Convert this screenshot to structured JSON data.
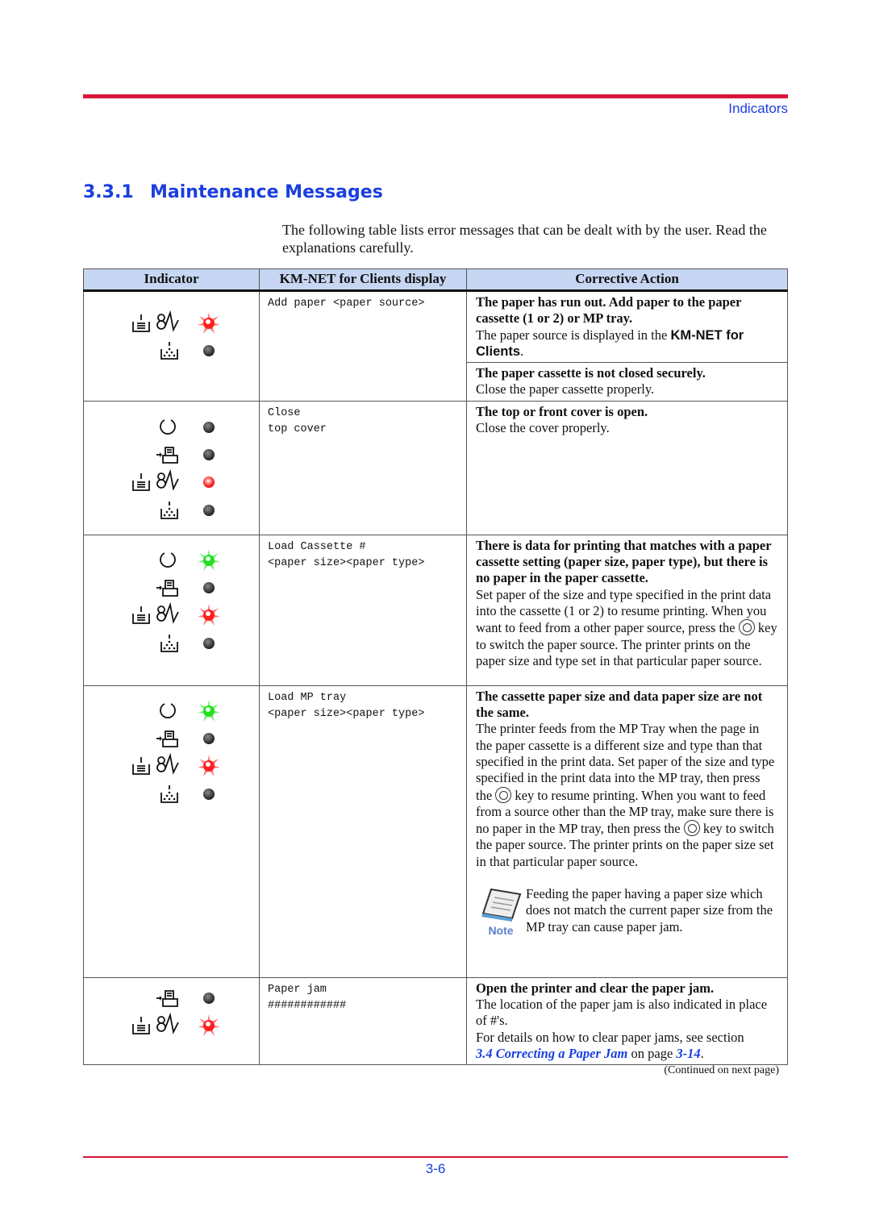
{
  "header": {
    "running_head": "Indicators"
  },
  "section": {
    "number": "3.3.1",
    "title": "Maintenance Messages"
  },
  "intro": "The following table lists error messages that can be dealt with by the user. Read the explanations carefully.",
  "table": {
    "headers": [
      "Indicator",
      "KM-NET for Clients display",
      "Corrective Action"
    ],
    "rows": [
      {
        "indicators": [
          {
            "icon": "paper-jam",
            "led": "red-blink"
          },
          {
            "icon": "toner",
            "led": "off"
          }
        ],
        "display": "Add paper <paper source>",
        "actions": [
          {
            "bold": "The paper has run out. Add paper to the paper cassette (1 or 2) or MP tray.",
            "text": "The paper source is displayed in the ",
            "sans": "KM-NET for Clients",
            "tail": "."
          },
          {
            "bold": "The paper cassette is not closed securely.",
            "text": "Close the paper cassette properly."
          }
        ]
      },
      {
        "indicators": [
          {
            "icon": "ready",
            "led": "off"
          },
          {
            "icon": "data",
            "led": "off"
          },
          {
            "icon": "paper-jam",
            "led": "red-on"
          },
          {
            "icon": "toner",
            "led": "off"
          }
        ],
        "display": "Close\ntop cover",
        "actions": [
          {
            "bold": "The top or front cover is open.",
            "text": "Close the cover properly."
          }
        ]
      },
      {
        "indicators": [
          {
            "icon": "ready",
            "led": "green-blink"
          },
          {
            "icon": "data",
            "led": "off"
          },
          {
            "icon": "paper-jam",
            "led": "red-blink"
          },
          {
            "icon": "toner",
            "led": "off"
          }
        ],
        "display": "Load Cassette #\n<paper size><paper type>",
        "actions": [
          {
            "bold": "There is data for printing that matches with a paper cassette setting (paper size, paper type), but there is no paper in the paper cassette.",
            "text1": "Set paper of the size and type specified in the print data into the cassette (1 or 2) to resume printing. When you want to feed from a other paper source, press the",
            "text2": "key to switch the paper source. The printer prints on the paper size and type set in that particular paper source."
          }
        ]
      },
      {
        "indicators": [
          {
            "icon": "ready",
            "led": "green-blink"
          },
          {
            "icon": "data",
            "led": "off"
          },
          {
            "icon": "paper-jam",
            "led": "red-blink"
          },
          {
            "icon": "toner",
            "led": "off"
          }
        ],
        "display": "Load MP tray\n<paper size><paper type>",
        "actions": [
          {
            "bold": "The cassette paper size and data paper size are not the same.",
            "text1": "The printer feeds from the MP Tray when the page in the paper cassette is a different size and type than that specified in the print data. Set paper of the size and type specified in the print data into the MP tray, then press the",
            "text2": "key to resume printing. When you want to feed from a source other than the MP tray, make sure there is no paper in the MP tray, then press the",
            "text3": "key to switch the paper source. The printer prints on the paper size set in that particular paper source.",
            "note_label": "Note",
            "note": "Feeding the paper having a paper size which does not match the current paper size from the MP tray can cause paper jam."
          }
        ]
      },
      {
        "indicators": [
          {
            "icon": "data",
            "led": "off"
          },
          {
            "icon": "paper-jam",
            "led": "red-blink"
          }
        ],
        "display": "Paper jam\n############",
        "actions": [
          {
            "bold": "Open the printer and clear the paper jam.",
            "text1": "The location of the paper jam is also indicated in place of #'s.",
            "text2": "For details on how to clear paper jams, see section",
            "link": "3.4 Correcting a Paper Jam",
            "text3": "on page",
            "page_link": "3-14",
            "tail": "."
          }
        ]
      }
    ]
  },
  "continued": "(Continued on next page)",
  "footer": {
    "page": "3-6"
  },
  "colors": {
    "accent_red": "#d9143a",
    "link_blue": "#1a3fe0",
    "header_bg": "#c7d6f2"
  }
}
